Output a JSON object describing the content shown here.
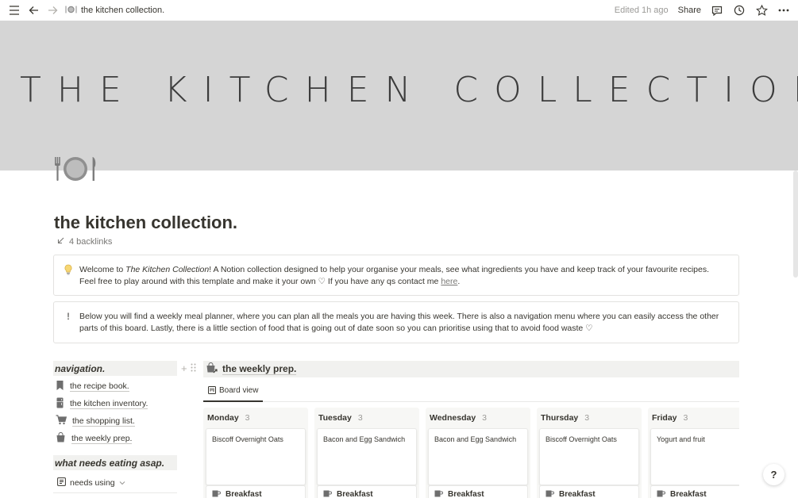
{
  "topbar": {
    "breadcrumb": "the kitchen collection.",
    "edited": "Edited 1h ago",
    "share": "Share",
    "icons": [
      "menu-icon",
      "back-arrow-icon",
      "forward-arrow-icon",
      "plate-icon",
      "comment-icon",
      "clock-icon",
      "star-icon",
      "more-icon"
    ]
  },
  "cover": {
    "title": "THE KITCHEN COLLECTION"
  },
  "page": {
    "title": "the kitchen collection.",
    "backlinks": "4 backlinks"
  },
  "callouts": [
    {
      "icon": "lightbulb-icon",
      "text_pre": "Welcome to ",
      "text_italic": "The Kitchen Collection",
      "text_post": "! A Notion collection designed to help your organise your meals, see what ingredients you have and keep track of your favourite recipes. Feel free to play around with this template and make it your own ♡ If you have any qs contact me ",
      "link": "here",
      "text_end": "."
    },
    {
      "icon": "exclamation-icon",
      "text": "Below you will find a weekly meal planner, where you can plan all the meals you are having this week.  There is also a navigation menu where you can easily access the other parts of this board. Lastly, there is a little section of food that is going out of date soon so you can prioritise using that to avoid food waste ♡"
    }
  ],
  "sidebar": {
    "heading": "navigation.",
    "items": [
      {
        "label": "the recipe book.",
        "icon": "bookmark-icon"
      },
      {
        "label": "the kitchen inventory.",
        "icon": "fridge-icon"
      },
      {
        "label": "the shopping list.",
        "icon": "cart-icon"
      },
      {
        "label": "the weekly prep.",
        "icon": "bag-icon"
      }
    ],
    "eat_heading": "what needs eating asap.",
    "needs_view": "needs using"
  },
  "weekly": {
    "heading": "the weekly prep.",
    "tab": "Board view",
    "columns": [
      {
        "day": "Monday",
        "count": "3",
        "meal": "Biscoff Overnight Oats",
        "tag": "Breakfast"
      },
      {
        "day": "Tuesday",
        "count": "3",
        "meal": "Bacon and Egg Sandwich",
        "tag": "Breakfast"
      },
      {
        "day": "Wednesday",
        "count": "3",
        "meal": "Bacon and Egg Sandwich",
        "tag": "Breakfast"
      },
      {
        "day": "Thursday",
        "count": "3",
        "meal": "Biscoff Overnight Oats",
        "tag": "Breakfast"
      },
      {
        "day": "Friday",
        "count": "3",
        "meal": "Yogurt and fruit",
        "tag": "Breakfast"
      }
    ]
  },
  "help": "?"
}
